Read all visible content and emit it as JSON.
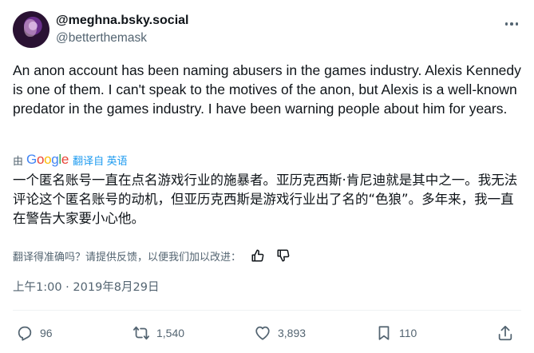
{
  "author": {
    "display_name": "@meghna.bsky.social",
    "handle": "@betterthemask"
  },
  "tweet": {
    "text": "An anon account has been naming abusers in the games industry. Alexis Kennedy is one of them. I can't speak to the motives of the anon, but Alexis is a well-known predator in the games industry. I have been warning people about him for years."
  },
  "translation": {
    "by_label": "由",
    "provider": "Google",
    "link_label": "翻译自 英语",
    "text": "一个匿名账号一直在点名游戏行业的施暴者。亚历克西斯·肯尼迪就是其中之一。我无法评论这个匿名账号的动机，但亚历克西斯是游戏行业出了名的“色狼”。多年来，我一直在警告大家要小心他。",
    "feedback_prompt": "翻译得准确吗？请提供反馈，以便我们加以改进："
  },
  "timestamp": "上午1:00 · 2019年8月29日",
  "stats": {
    "replies": "96",
    "reposts": "1,540",
    "likes": "3,893",
    "bookmarks": "110"
  },
  "icons": {
    "more": "more-icon",
    "thumbs_up": "thumbs-up-icon",
    "thumbs_down": "thumbs-down-icon",
    "reply": "reply-icon",
    "repost": "repost-icon",
    "like": "heart-icon",
    "bookmark": "bookmark-icon",
    "share": "share-icon"
  },
  "colors": {
    "text": "#0f1419",
    "secondary": "#536471",
    "link": "#1d9bf0"
  }
}
